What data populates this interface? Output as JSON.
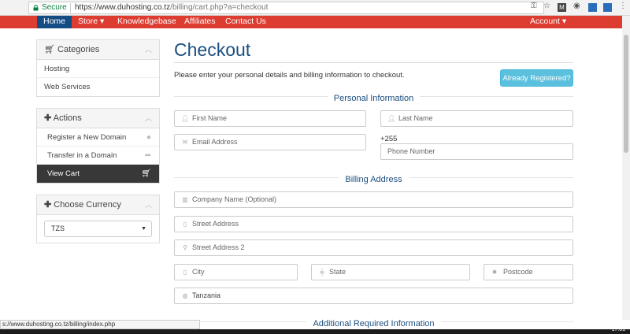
{
  "browser": {
    "secure_label": "Secure",
    "url_host": "https://www.duhosting.co.tz",
    "url_path": "/billing/cart.php?a=checkout",
    "status_url": "s://www.duhosting.co.tz/billing/index.php",
    "clock": "17:01"
  },
  "nav": {
    "home": "Home",
    "store": "Store ▾",
    "kb": "Knowledgebase",
    "affiliates": "Affiliates",
    "contact": "Contact Us",
    "account": "Account ▾"
  },
  "sidebar": {
    "categories": {
      "title": "Categories",
      "items": [
        "Hosting",
        "Web Services"
      ]
    },
    "actions": {
      "title": "Actions",
      "items": [
        "Register a New Domain",
        "Transfer in a Domain",
        "View Cart"
      ]
    },
    "currency": {
      "title": "Choose Currency",
      "selected": "TZS"
    }
  },
  "main": {
    "title": "Checkout",
    "intro": "Please enter your personal details and billing information to checkout.",
    "already_registered": "Already Registered?",
    "sections": {
      "personal": "Personal Information",
      "billing": "Billing Address",
      "additional": "Additional Required Information"
    },
    "fields": {
      "first_name": "First Name",
      "last_name": "Last Name",
      "email": "Email Address",
      "phone_prefix": "+255",
      "phone": "Phone Number",
      "company": "Company Name (Optional)",
      "street1": "Street Address",
      "street2": "Street Address 2",
      "city": "City",
      "state": "State",
      "postcode": "Postcode",
      "country": "Tanzania"
    }
  },
  "colors": {
    "nav_red": "#dd3c31",
    "nav_active": "#144d84",
    "title_blue": "#1c4f80",
    "button_info": "#5bc0de"
  }
}
